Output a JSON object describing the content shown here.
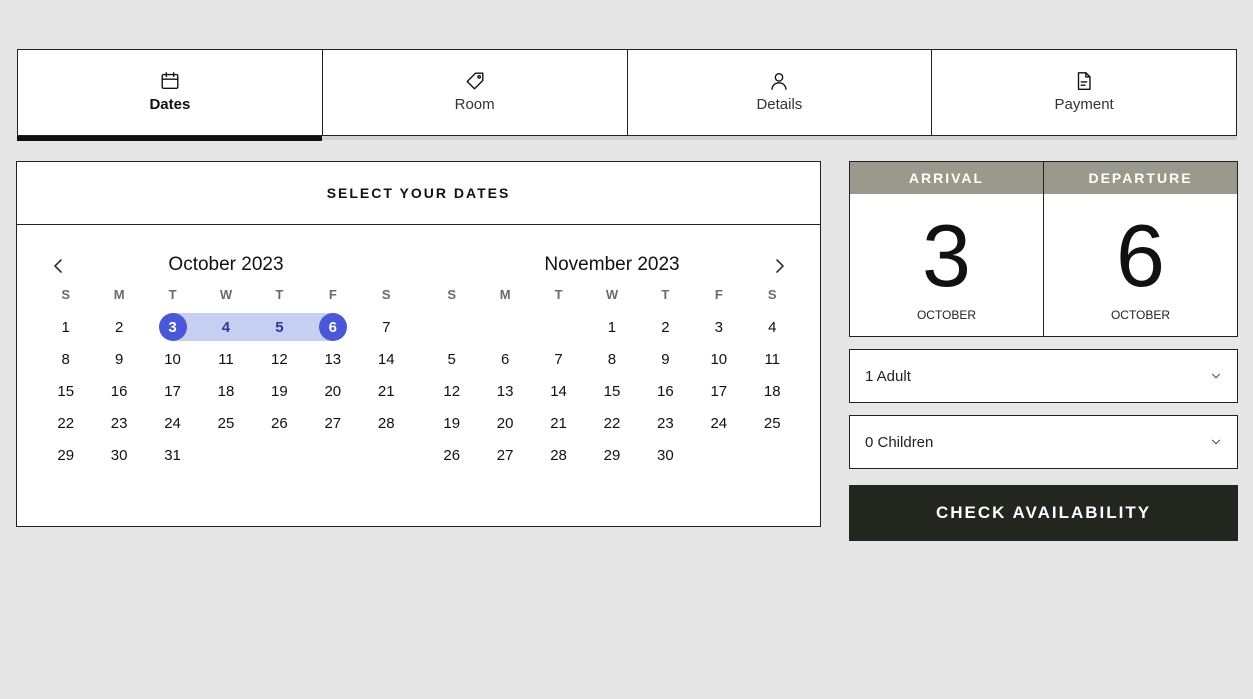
{
  "steps": [
    {
      "label": "Dates",
      "icon": "calendar-icon",
      "active": true
    },
    {
      "label": "Room",
      "icon": "tag-icon",
      "active": false
    },
    {
      "label": "Details",
      "icon": "user-icon",
      "active": false
    },
    {
      "label": "Payment",
      "icon": "document-icon",
      "active": false
    }
  ],
  "calendar": {
    "heading": "SELECT YOUR DATES",
    "weekdays": [
      "S",
      "M",
      "T",
      "W",
      "T",
      "F",
      "S"
    ],
    "months": [
      {
        "title": "October 2023",
        "weeks": [
          [
            "1",
            "2",
            "3",
            "4",
            "5",
            "6",
            "7"
          ],
          [
            "8",
            "9",
            "10",
            "11",
            "12",
            "13",
            "14"
          ],
          [
            "15",
            "16",
            "17",
            "18",
            "19",
            "20",
            "21"
          ],
          [
            "22",
            "23",
            "24",
            "25",
            "26",
            "27",
            "28"
          ],
          [
            "29",
            "30",
            "31",
            "",
            "",
            "",
            ""
          ]
        ]
      },
      {
        "title": "November 2023",
        "weeks": [
          [
            "",
            "",
            "",
            "1",
            "2",
            "3",
            "4"
          ],
          [
            "5",
            "6",
            "7",
            "8",
            "9",
            "10",
            "11"
          ],
          [
            "12",
            "13",
            "14",
            "15",
            "16",
            "17",
            "18"
          ],
          [
            "19",
            "20",
            "21",
            "22",
            "23",
            "24",
            "25"
          ],
          [
            "26",
            "27",
            "28",
            "29",
            "30",
            "",
            ""
          ]
        ]
      }
    ],
    "selection": {
      "month": "October 2023",
      "start": "3",
      "end": "6",
      "in_range": [
        "4",
        "5"
      ]
    },
    "colors": {
      "selected": "#4a57d6",
      "range": "#c6cff2",
      "range_text": "#2b3a9b"
    }
  },
  "arrival": {
    "label": "ARRIVAL",
    "day": "3",
    "month": "OCTOBER"
  },
  "departure": {
    "label": "DEPARTURE",
    "day": "6",
    "month": "OCTOBER"
  },
  "adults": {
    "value": "1 Adult"
  },
  "children": {
    "value": "0 Children"
  },
  "cta": {
    "label": "CHECK AVAILABILITY",
    "color": "#22261f"
  },
  "colors": {
    "date_header": "#9a998d",
    "background": "#e6e6e6"
  }
}
